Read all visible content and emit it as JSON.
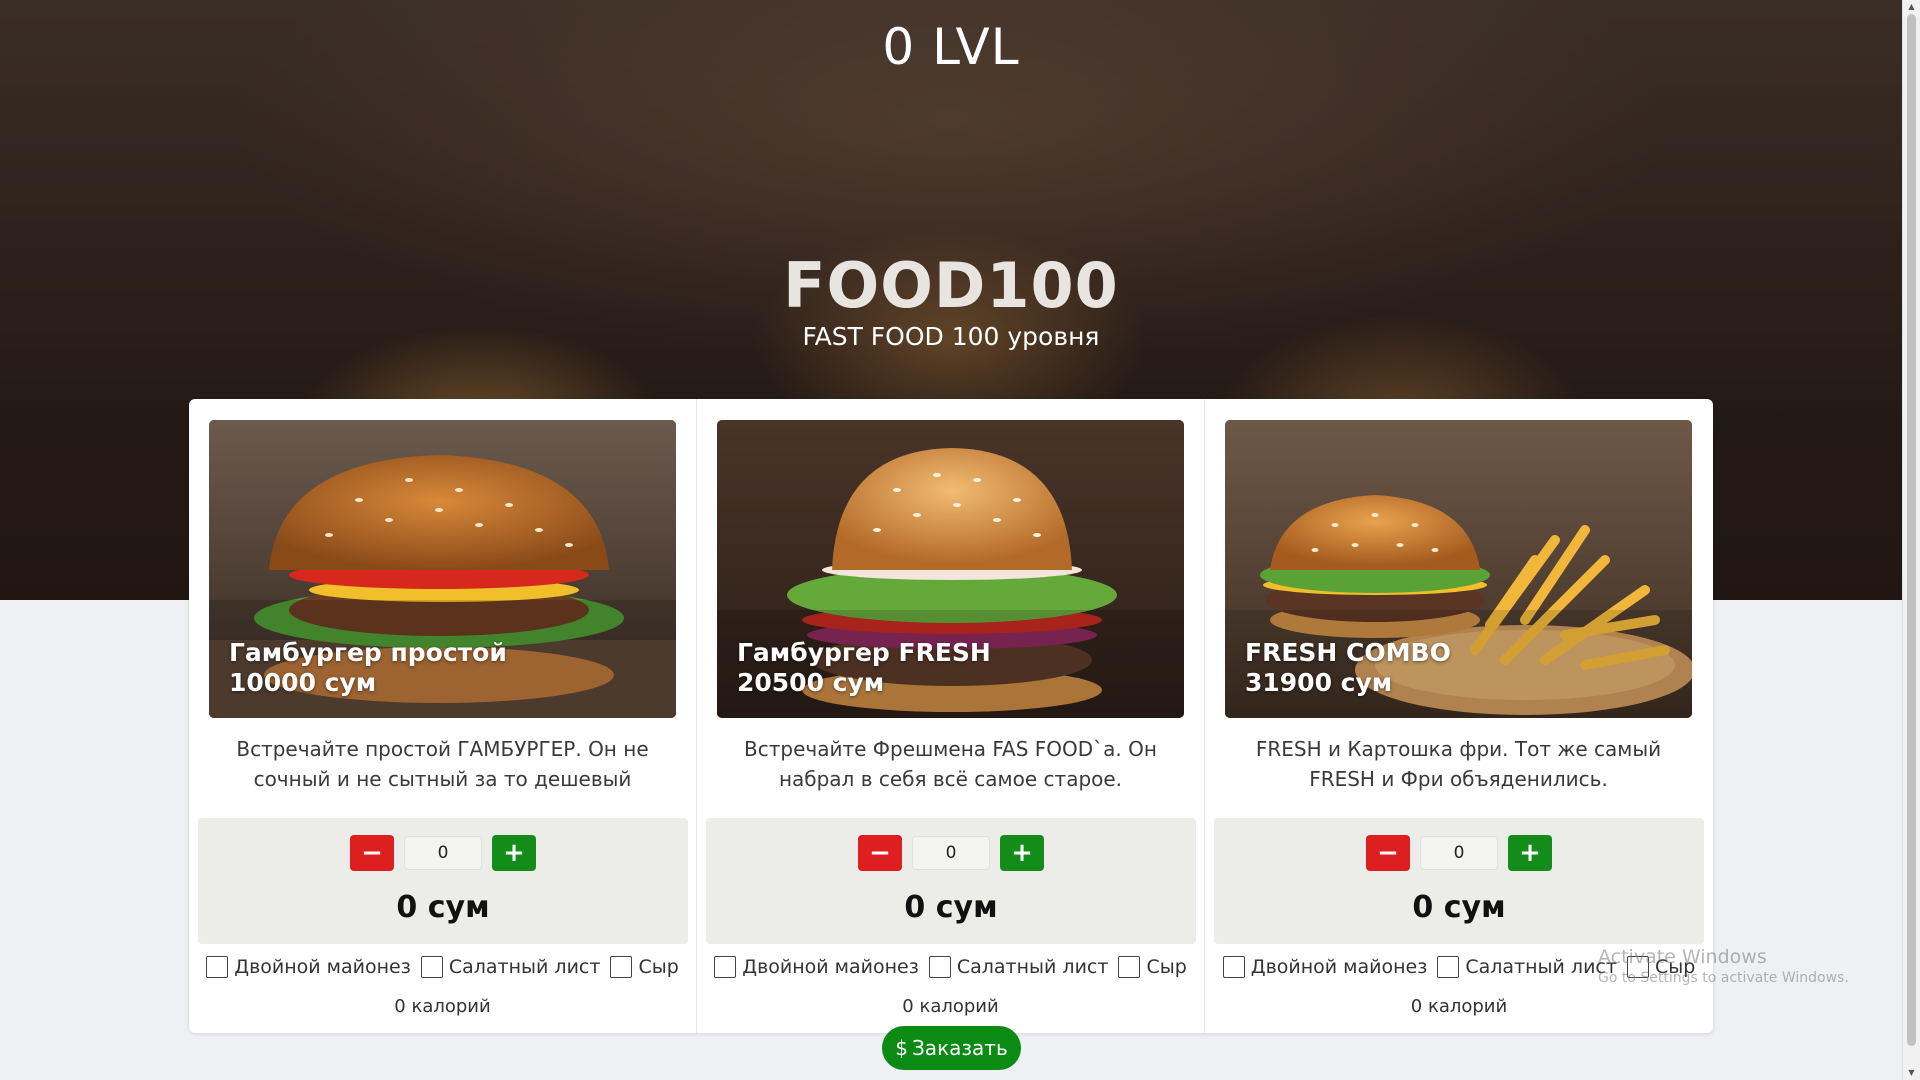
{
  "header": {
    "level": "0 LVL"
  },
  "brand": {
    "title": "FOOD100",
    "subtitle": "FAST FOOD 100 уровня"
  },
  "products": [
    {
      "name": "Гамбургер простой",
      "price_label": "10000 сум",
      "description": "Встречайте простой ГАМБУРГЕР. Он не сочный и не сытный за то дешевый",
      "quantity": "0",
      "total": "0 сум",
      "extras": [
        "Двойной майонез",
        "Салатный лист",
        "Сыр"
      ],
      "calories": "0 калорий"
    },
    {
      "name": "Гамбургер FRESH",
      "price_label": "20500 сум",
      "description": "Встречайте Фрешмена FAS FOOD`а. Он набрал в себя всё самое старое.",
      "quantity": "0",
      "total": "0 сум",
      "extras": [
        "Двойной майонез",
        "Салатный лист",
        "Сыр"
      ],
      "calories": "0 калорий"
    },
    {
      "name": "FRESH COMBO",
      "price_label": "31900 сум",
      "description": "FRESH и Картошка фри. Тот же самый FRESH и Фри объяденились.",
      "quantity": "0",
      "total": "0 сум",
      "extras": [
        "Двойной майонез",
        "Салатный лист",
        "Сыр"
      ],
      "calories": "0 калорий"
    }
  ],
  "controls": {
    "minus": "−",
    "plus": "+"
  },
  "order": {
    "icon": "dollar-icon",
    "icon_glyph": "$",
    "label": "Заказать"
  },
  "watermark": {
    "line1": "Activate Windows",
    "line2": "Go to Settings to activate Windows."
  },
  "colors": {
    "minus": "#dd1f1f",
    "plus": "#138c1a",
    "order": "#0b8a14"
  }
}
